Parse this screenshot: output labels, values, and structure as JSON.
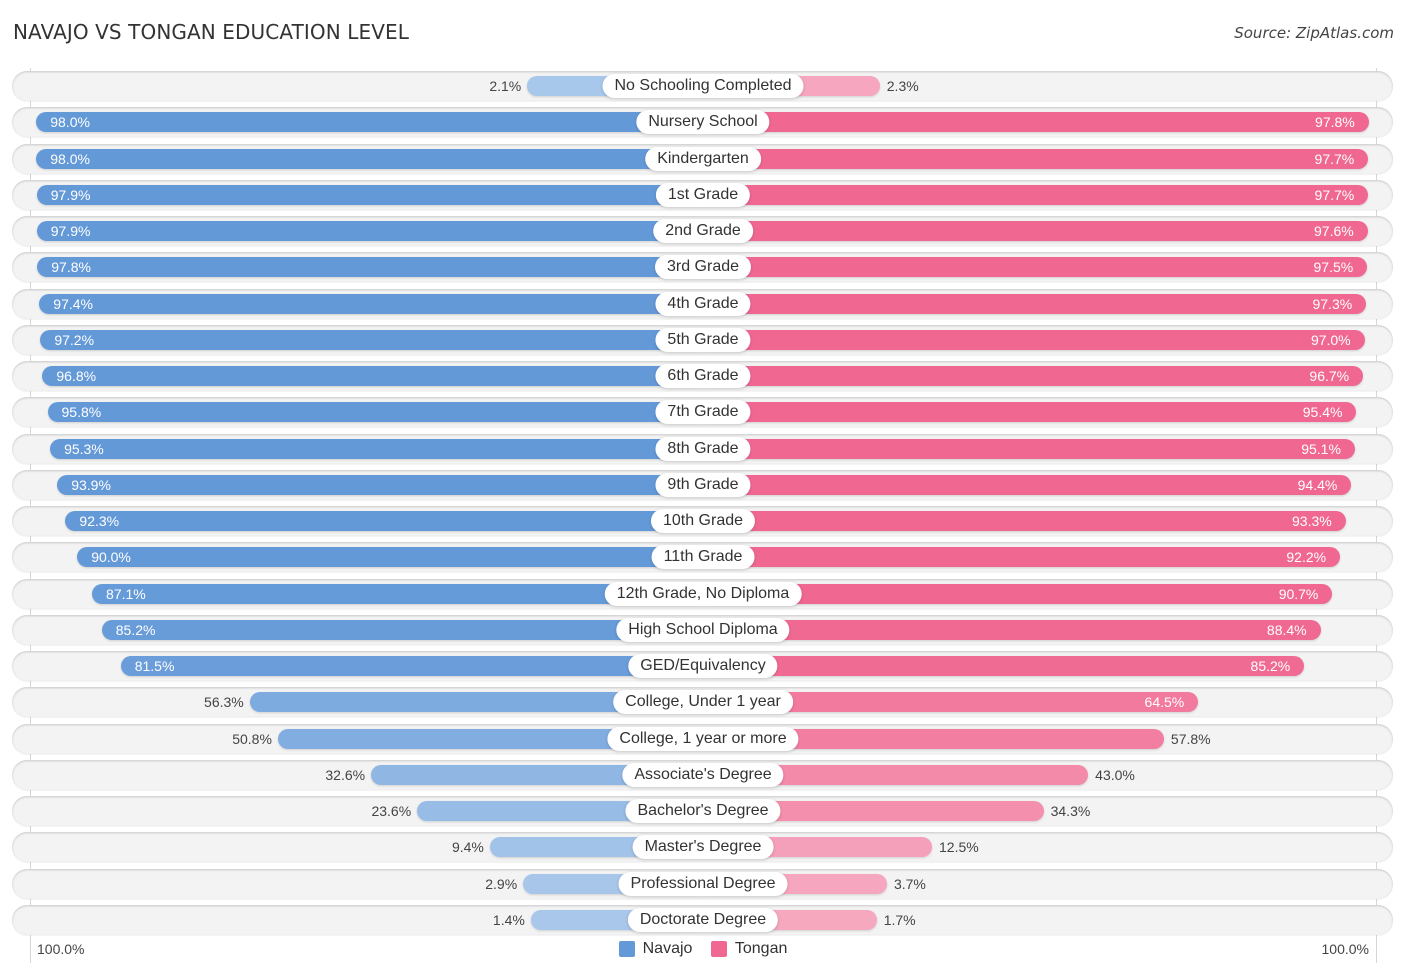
{
  "header": {
    "title": "NAVAJO VS TONGAN EDUCATION LEVEL",
    "source": "Source: ZipAtlas.com"
  },
  "axis": {
    "left_label": "100.0%",
    "right_label": "100.0%"
  },
  "colors": {
    "navajo_strong": "#6499d8",
    "navajo_light": "#a9c8eb",
    "tongan_strong": "#f06892",
    "tongan_light": "#f6a9c0"
  },
  "chart_data": {
    "type": "bar",
    "orientation": "horizontal-diverging",
    "title": "NAVAJO VS TONGAN EDUCATION LEVEL",
    "xlabel": "",
    "ylabel": "",
    "xlim": [
      0,
      100
    ],
    "unit": "%",
    "legend_position": "bottom-center",
    "categories": [
      "No Schooling Completed",
      "Nursery School",
      "Kindergarten",
      "1st Grade",
      "2nd Grade",
      "3rd Grade",
      "4th Grade",
      "5th Grade",
      "6th Grade",
      "7th Grade",
      "8th Grade",
      "9th Grade",
      "10th Grade",
      "11th Grade",
      "12th Grade, No Diploma",
      "High School Diploma",
      "GED/Equivalency",
      "College, Under 1 year",
      "College, 1 year or more",
      "Associate's Degree",
      "Bachelor's Degree",
      "Master's Degree",
      "Professional Degree",
      "Doctorate Degree"
    ],
    "series": [
      {
        "name": "Navajo",
        "side": "left",
        "color": "#6499d8",
        "values": [
          2.1,
          98.0,
          98.0,
          97.9,
          97.9,
          97.8,
          97.4,
          97.2,
          96.8,
          95.8,
          95.3,
          93.9,
          92.3,
          90.0,
          87.1,
          85.2,
          81.5,
          56.3,
          50.8,
          32.6,
          23.6,
          9.4,
          2.9,
          1.4
        ],
        "labels": [
          "2.1%",
          "98.0%",
          "98.0%",
          "97.9%",
          "97.9%",
          "97.8%",
          "97.4%",
          "97.2%",
          "96.8%",
          "95.8%",
          "95.3%",
          "93.9%",
          "92.3%",
          "90.0%",
          "87.1%",
          "85.2%",
          "81.5%",
          "56.3%",
          "50.8%",
          "32.6%",
          "23.6%",
          "9.4%",
          "2.9%",
          "1.4%"
        ]
      },
      {
        "name": "Tongan",
        "side": "right",
        "color": "#f06892",
        "values": [
          2.3,
          97.8,
          97.7,
          97.7,
          97.6,
          97.5,
          97.3,
          97.0,
          96.7,
          95.4,
          95.1,
          94.4,
          93.3,
          92.2,
          90.7,
          88.4,
          85.2,
          64.5,
          57.8,
          43.0,
          34.3,
          12.5,
          3.7,
          1.7
        ],
        "labels": [
          "2.3%",
          "97.8%",
          "97.7%",
          "97.7%",
          "97.6%",
          "97.5%",
          "97.3%",
          "97.0%",
          "96.7%",
          "95.4%",
          "95.1%",
          "94.4%",
          "93.3%",
          "92.2%",
          "90.7%",
          "88.4%",
          "85.2%",
          "64.5%",
          "57.8%",
          "43.0%",
          "34.3%",
          "12.5%",
          "3.7%",
          "1.7%"
        ]
      }
    ],
    "legend": [
      "Navajo",
      "Tongan"
    ]
  }
}
